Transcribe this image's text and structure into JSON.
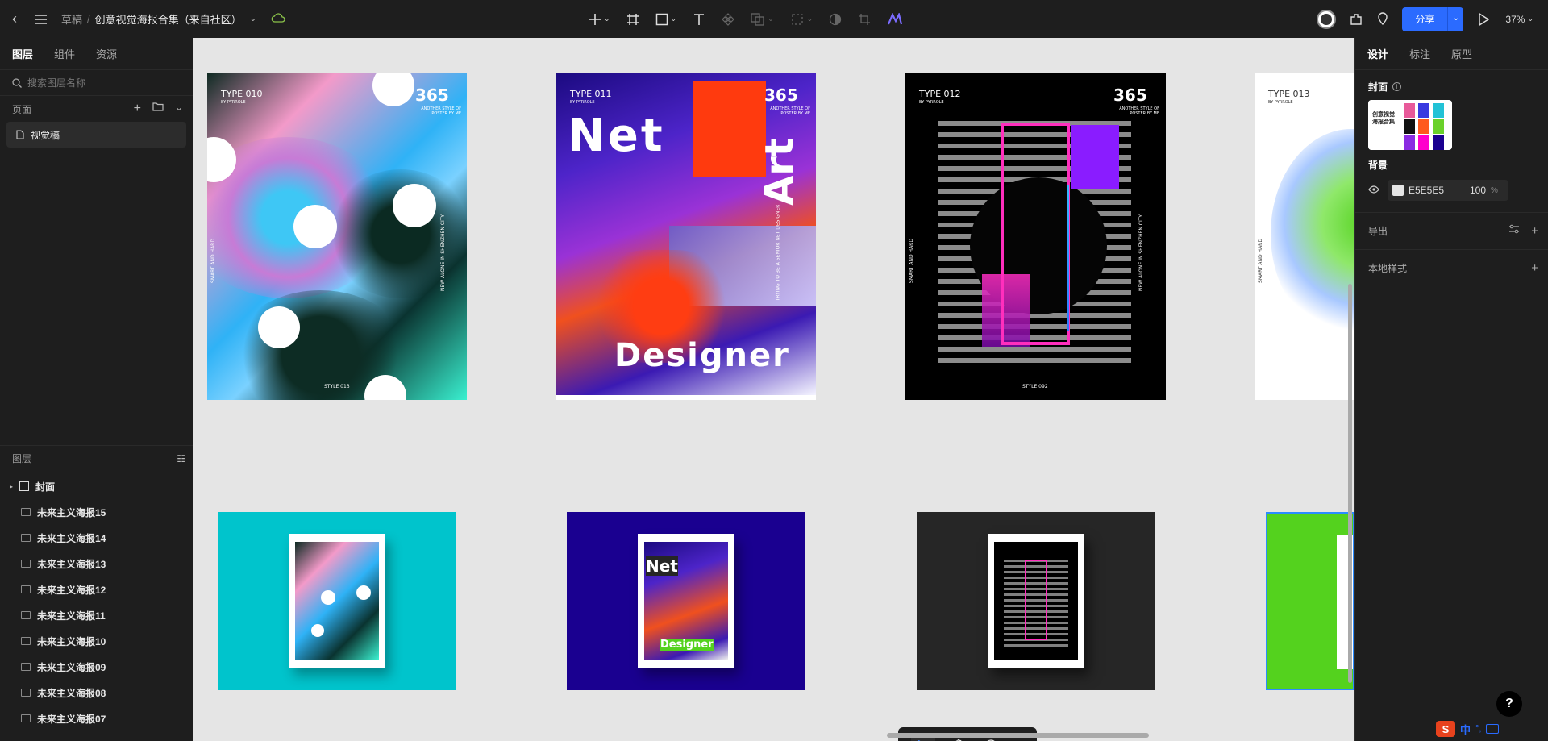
{
  "topbar": {
    "breadcrumb_root": "草稿",
    "breadcrumb_sep": "/",
    "file_name": "创意视觉海报合集（来自社区）",
    "share_label": "分享",
    "zoom": "37%"
  },
  "left": {
    "tabs": [
      "图层",
      "组件",
      "资源"
    ],
    "search_placeholder": "搜索图层名称",
    "pages_label": "页面",
    "pages": [
      "视觉稿"
    ],
    "layers_label": "图层",
    "layers": [
      "封面",
      "未来主义海报15",
      "未来主义海报14",
      "未来主义海报13",
      "未来主义海报12",
      "未来主义海报11",
      "未来主义海报10",
      "未来主义海报09",
      "未来主义海报08",
      "未来主义海报07"
    ]
  },
  "right": {
    "tabs": [
      "设计",
      "标注",
      "原型"
    ],
    "cover_label": "封面",
    "cover_thumb_text": "创意视觉 海报合集",
    "bg_label": "背景",
    "bg_hex": "E5E5E5",
    "bg_opacity": "100",
    "bg_unit": "%",
    "export_label": "导出",
    "local_style_label": "本地样式"
  },
  "posters": [
    {
      "type": "TYPE 010",
      "by": "BY PYRROLE",
      "num": "365",
      "sub": "ANOTHER STYLE OF POSTER BY ME",
      "side_left": "SMART AND HARD",
      "side_right": "NEW ALONE IN SHENZHEN CITY",
      "style": "STYLE 013"
    },
    {
      "type": "TYPE 011",
      "by": "BY PYRROLE",
      "num": "365",
      "sub": "ANOTHER STYLE OF POSTER BY ME",
      "big1": "Net",
      "big2": "Designer",
      "big3": "Art",
      "side_right": "TRYING TO BE A SENIOR NET DESIGNER"
    },
    {
      "type": "TYPE 012",
      "by": "BY PYRROLE",
      "num": "365",
      "sub": "ANOTHER STYLE OF POSTER BY ME",
      "side_left": "SMART AND HARD",
      "side_right": "NEW ALONE IN SHENZHEN CITY",
      "style": "STYLE 092"
    },
    {
      "type": "TYPE 013",
      "by": "BY PYRROLE",
      "side_left": "SMART AND HARD"
    }
  ],
  "mockups": [
    {
      "bg": "#00c4cc"
    },
    {
      "bg": "#1a0090",
      "text1": "Net",
      "text2": "Designer"
    },
    {
      "bg": "#262626"
    },
    {
      "bg": "#54d21e"
    }
  ],
  "ime": {
    "text": "中",
    "punct": "°,"
  }
}
